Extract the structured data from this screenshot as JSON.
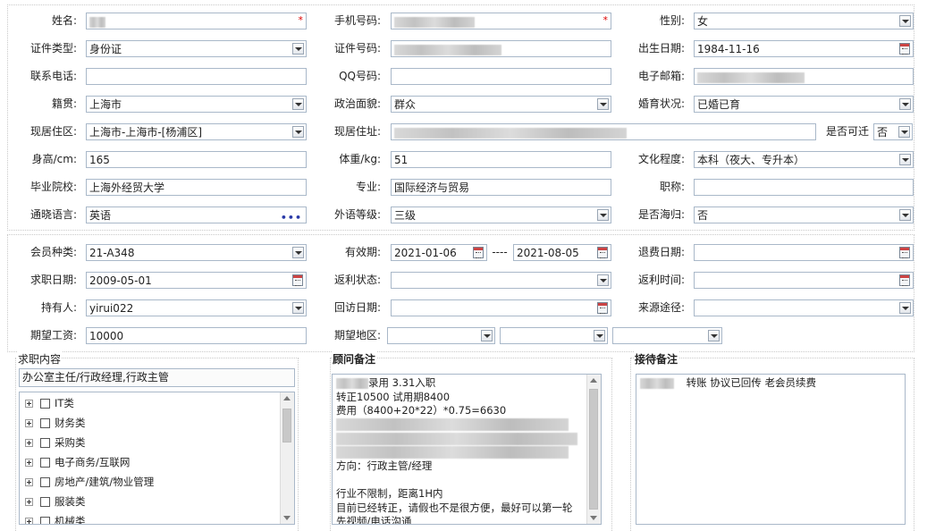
{
  "personal": {
    "name_label": "姓名:",
    "phone_label": "手机号码:",
    "gender_label": "性别:",
    "gender_value": "女",
    "id_type_label": "证件类型:",
    "id_type_value": "身份证",
    "id_no_label": "证件号码:",
    "birth_label": "出生日期:",
    "birth_value": "1984-11-16",
    "contact_label": "联系电话:",
    "qq_label": "QQ号码:",
    "email_label": "电子邮箱:",
    "native_label": "籍贯:",
    "native_value": "上海市",
    "politics_label": "政治面貌:",
    "politics_value": "群众",
    "marital_label": "婚育状况:",
    "marital_value": "已婚已育",
    "district_label": "现居住区:",
    "district_value": "上海市-上海市-[杨浦区]",
    "address_label": "现居住址:",
    "relocate_label": "是否可迁",
    "relocate_value": "否",
    "height_label": "身高/cm:",
    "height_value": "165",
    "weight_label": "体重/kg:",
    "weight_value": "51",
    "education_label": "文化程度:",
    "education_value": "本科（夜大、专升本）",
    "school_label": "毕业院校:",
    "school_value": "上海外经贸大学",
    "major_label": "专业:",
    "major_value": "国际经济与贸易",
    "title_label": "职称:",
    "language_label": "通晓语言:",
    "language_value": "英语",
    "language_more": "•••",
    "lang_level_label": "外语等级:",
    "lang_level_value": "三级",
    "overseas_label": "是否海归:",
    "overseas_value": "否"
  },
  "membership": {
    "type_label": "会员种类:",
    "type_value": "21-A348",
    "valid_label": "有效期:",
    "valid_from": "2021-01-06",
    "valid_sep": "----",
    "valid_to": "2021-08-05",
    "refund_label": "退费日期:",
    "jobdate_label": "求职日期:",
    "jobdate_value": "2009-05-01",
    "rebate_status_label": "返利状态:",
    "rebate_time_label": "返利时间:",
    "holder_label": "持有人:",
    "holder_value": "yirui022",
    "revisit_label": "回访日期:",
    "source_label": "来源途径:",
    "salary_label": "期望工资:",
    "salary_value": "10000",
    "region_label": "期望地区:"
  },
  "job_section": {
    "title": "求职内容",
    "summary": "办公室主任/行政经理,行政主管",
    "categories": [
      "IT类",
      "财务类",
      "采购类",
      "电子商务/互联网",
      "房地产/建筑/物业管理",
      "服装类",
      "机械类"
    ]
  },
  "advisor_section": {
    "title": "顾问备注",
    "lines": [
      "录用  3.31入职",
      "转正10500  试用期8400",
      "费用（8400+20*22）*0.75=6630",
      "",
      "",
      "",
      "方向：行政主管/经理",
      "",
      "行业不限制，距离1H内",
      "目前已经转正，请假也不是很方便，最好可以第一轮",
      "先视频/电话沟通"
    ]
  },
  "reception_section": {
    "title": "接待备注",
    "text": "转账 协议已回传  老会员续费"
  },
  "colors": {
    "border": "#a9b8c9",
    "required": "#dd0000",
    "section_border": "#c9c9c9"
  }
}
